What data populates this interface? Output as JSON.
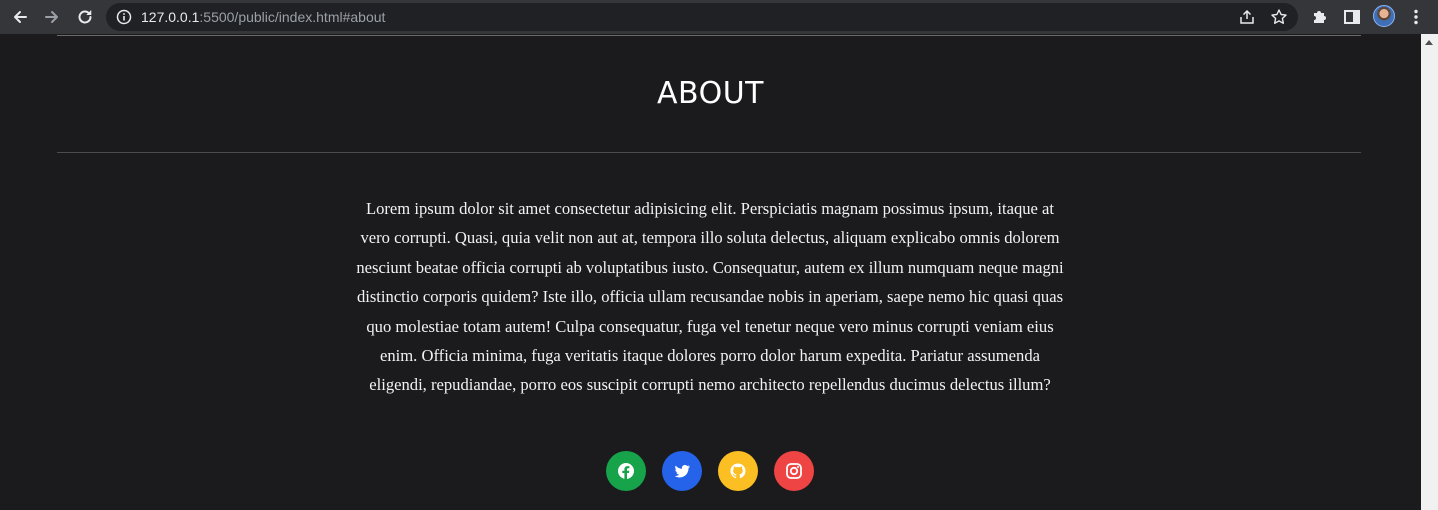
{
  "browser": {
    "url_host": "127.0.0.1",
    "url_rest": ":5500/public/index.html#about"
  },
  "about": {
    "title": "ABOUT",
    "body": "Lorem ipsum dolor sit amet consectetur adipisicing elit. Perspiciatis magnam possimus ipsum, itaque at vero corrupti. Quasi, quia velit non aut at, tempora illo soluta delectus, aliquam explicabo omnis dolorem nesciunt beatae officia corrupti ab voluptatibus iusto. Consequatur, autem ex illum numquam neque magni distinctio corporis quidem? Iste illo, officia ullam recusandae nobis in aperiam, saepe nemo hic quasi quas quo molestiae totam autem! Culpa consequatur, fuga vel tenetur neque vero minus corrupti veniam eius enim. Officia minima, fuga veritatis itaque dolores porro dolor harum expedita. Pariatur assumenda eligendi, repudiandae, porro eos suscipit corrupti nemo architecto repellendus ducimus delectus illum?"
  },
  "socials": [
    {
      "icon": "facebook-icon",
      "color": "#16a34a"
    },
    {
      "icon": "twitter-icon",
      "color": "#2563eb"
    },
    {
      "icon": "github-icon",
      "color": "#fbbf24"
    },
    {
      "icon": "instagram-icon",
      "color": "#ef4444"
    }
  ]
}
